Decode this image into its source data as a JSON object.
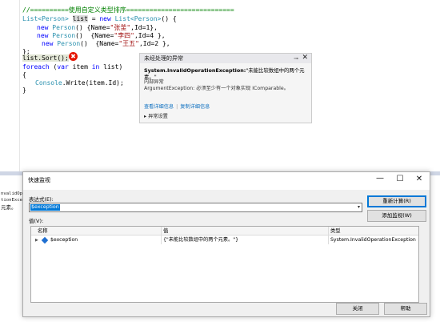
{
  "editor": {
    "comment_line": "//==========使用自定义类型排序============================",
    "line2": {
      "type1": "List<Person>",
      "var": "list",
      "eq": " = ",
      "new_kw": "new",
      "type2": " List<Person>",
      "rest": "() {"
    },
    "persons": [
      {
        "new_kw": "new",
        "type": " Person",
        "pre": "() {Name=",
        "name": "\"张釜\"",
        "post": ",Id=1},"
      },
      {
        "new_kw": "new",
        "type": " Person",
        "pre": "()  {Name=",
        "name": "\"李四\"",
        "post": ",Id=4 },"
      },
      {
        "new_kw": "new",
        "type": " Person",
        "pre": "()  {Name=",
        "name": "\"王五\"",
        "post": ",Id=2 },"
      }
    ],
    "close_line": "};",
    "sort_line": "list.Sort();",
    "foreach_line": {
      "kw1": "foreach",
      "p1": " (",
      "kw2": "var",
      "p2": " item ",
      "kw3": "in",
      "p3": " list)"
    },
    "open_brace": "{",
    "console_line": {
      "type": "Console",
      "rest": ".Write(item.Id);"
    },
    "close_brace": "}",
    "error_glyph": "✖"
  },
  "exception_popup": {
    "title": "未经处理的异常",
    "pin_glyph": "⊸",
    "close_glyph": "✕",
    "exception_type": "System.InvalidOperationException:",
    "exception_message": "\"未能比较数组中的两个元素。\"",
    "inner_label": "内部异常",
    "inner_message": "ArgumentException: 必须至少有一个对象实现 IComparable。",
    "link_details": "查看详细信息",
    "link_copy": "复制详细信息",
    "settings_label": "▸ 异常设置"
  },
  "output": {
    "lines": [
      "nvalidOper",
      "tionExcep",
      "元素。"
    ]
  },
  "quick_watch": {
    "title": "快速监视",
    "minimize_glyph": "—",
    "maximize_glyph": "☐",
    "close_glyph": "✕",
    "expression_label": "表达式(E):",
    "expression_value": "$exception",
    "dropdown_glyph": "▾",
    "value_label": "值(V):",
    "recalc_button": "重新计算(R)",
    "add_watch_button": "添加监视(W)",
    "columns": [
      "名称",
      "值",
      "类型"
    ],
    "rows": [
      {
        "toggle": "▶",
        "name": "$exception",
        "value": "{\"未能比较数组中的两个元素。\"}",
        "type": "System.InvalidOperationException"
      }
    ],
    "close_button": "关闭",
    "help_button": "帮助"
  }
}
